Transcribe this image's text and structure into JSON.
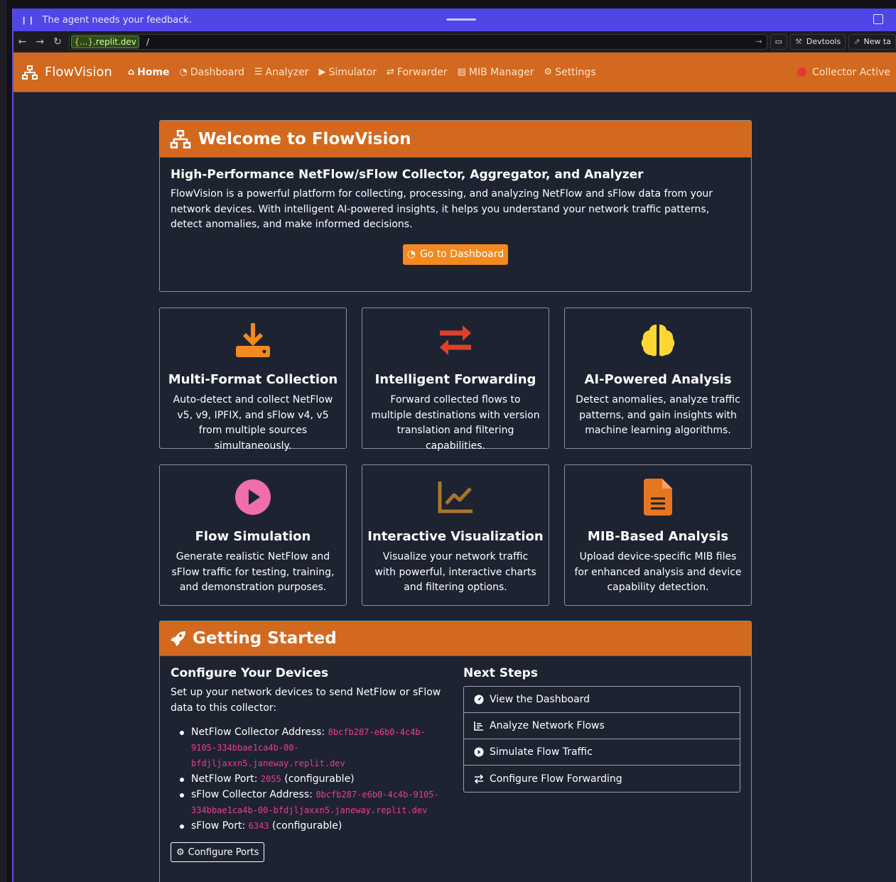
{
  "agent_bar": {
    "message": "The agent needs your feedback."
  },
  "browser": {
    "url_host_prefix": "{...}",
    "url_host_suffix": ".replit.dev",
    "url_path": "/",
    "devtools_label": "Devtools",
    "new_tab_label": "New ta"
  },
  "nav": {
    "brand": "FlowVision",
    "links": [
      {
        "label": "Home",
        "icon": "home-icon",
        "active": true
      },
      {
        "label": "Dashboard",
        "icon": "gauge-icon"
      },
      {
        "label": "Analyzer",
        "icon": "chart-bars-icon"
      },
      {
        "label": "Simulator",
        "icon": "play-icon"
      },
      {
        "label": "Forwarder",
        "icon": "exchange-icon"
      },
      {
        "label": "MIB Manager",
        "icon": "file-icon"
      },
      {
        "label": "Settings",
        "icon": "gear-icon"
      }
    ],
    "status": "Collector Active",
    "status_color": "#e53935"
  },
  "welcome": {
    "title": "Welcome to FlowVision",
    "subtitle": "High-Performance NetFlow/sFlow Collector, Aggregator, and Analyzer",
    "description": "FlowVision is a powerful platform for collecting, processing, and analyzing NetFlow and sFlow data from your network devices. With intelligent AI-powered insights, it helps you understand your network traffic patterns, detect anomalies, and make informed decisions.",
    "button": "Go to Dashboard"
  },
  "features": [
    {
      "title": "Multi-Format Collection",
      "icon": "download-icon",
      "color": "#f28a1f",
      "desc": "Auto-detect and collect NetFlow v5, v9, IPFIX, and sFlow v4, v5 from multiple sources simultaneously."
    },
    {
      "title": "Intelligent Forwarding",
      "icon": "exchange-icon",
      "color": "#e0402a",
      "desc": "Forward collected flows to multiple destinations with version translation and filtering capabilities."
    },
    {
      "title": "AI-Powered Analysis",
      "icon": "brain-icon",
      "color": "#fdd835",
      "desc": "Detect anomalies, analyze traffic patterns, and gain insights with machine learning algorithms."
    },
    {
      "title": "Flow Simulation",
      "icon": "play-circle-icon",
      "color": "#f06eaa",
      "desc": "Generate realistic NetFlow and sFlow traffic for testing, training, and demonstration purposes."
    },
    {
      "title": "Interactive Visualization",
      "icon": "line-chart-icon",
      "color": "#a9742b",
      "desc": "Visualize your network traffic with powerful, interactive charts and filtering options."
    },
    {
      "title": "MIB-Based Analysis",
      "icon": "document-icon",
      "color": "#e8761e",
      "desc": "Upload device-specific MIB files for enhanced analysis and device capability detection."
    }
  ],
  "getting_started": {
    "title": "Getting Started",
    "configure": {
      "heading": "Configure Your Devices",
      "intro": "Set up your network devices to send NetFlow or sFlow data to this collector:",
      "items": [
        {
          "label": "NetFlow Collector Address:",
          "value_lines": [
            "8bcfb287-e6b0-4c4b-",
            "9105-334bbae1ca4b-00-",
            "bfdjljaxxn5.janeway.replit.dev"
          ],
          "suffix": ""
        },
        {
          "label": "NetFlow Port:",
          "value_lines": [
            "2055"
          ],
          "suffix": "(configurable)"
        },
        {
          "label": "sFlow Collector Address:",
          "value_lines": [
            "8bcfb287-e6b0-4c4b-9105-",
            "334bbae1ca4b-00-bfdjljaxxn5.janeway.replit.dev"
          ],
          "suffix": ""
        },
        {
          "label": "sFlow Port:",
          "value_lines": [
            "6343"
          ],
          "suffix": "(configurable)"
        }
      ],
      "button": "Configure Ports"
    },
    "next_steps": {
      "heading": "Next Steps",
      "items": [
        {
          "label": "View the Dashboard",
          "icon": "gauge-icon"
        },
        {
          "label": "Analyze Network Flows",
          "icon": "chart-bars-icon"
        },
        {
          "label": "Simulate Flow Traffic",
          "icon": "play-circle-icon"
        },
        {
          "label": "Configure Flow Forwarding",
          "icon": "exchange-icon"
        }
      ]
    }
  }
}
